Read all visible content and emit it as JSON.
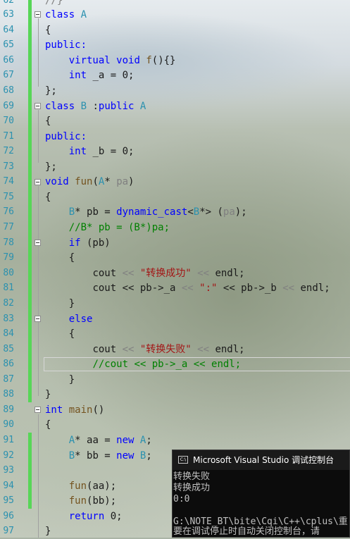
{
  "line_numbers": [
    "63",
    "64",
    "65",
    "66",
    "67",
    "68",
    "69",
    "70",
    "71",
    "72",
    "73",
    "74",
    "75",
    "76",
    "77",
    "78",
    "79",
    "80",
    "81",
    "82",
    "83",
    "84",
    "85",
    "86",
    "87",
    "88",
    "89",
    "90",
    "91",
    "92",
    "93",
    "94",
    "95",
    "96",
    "97"
  ],
  "top_partial": "//}",
  "code": {
    "l63": "class",
    "l63b": "A",
    "l64": "{",
    "l65": "public:",
    "l66a": "virtual",
    "l66b": "void",
    "l66c": "f",
    "l66d": "(){}",
    "l67a": "int",
    "l67b": " _a = 0;",
    "l68": "};",
    "l69a": "class",
    "l69b": "B",
    "l69c": " :",
    "l69d": "public",
    "l69e": "A",
    "l70": "{",
    "l71": "public:",
    "l72a": "int",
    "l72b": " _b = 0;",
    "l73": "};",
    "l74a": "void",
    "l74b": "fun",
    "l74c": "(",
    "l74d": "A",
    "l74e": "* ",
    "l74f": "pa",
    "l74g": ")",
    "l75": "{",
    "l76a": "B",
    "l76b": "* pb = ",
    "l76c": "dynamic_cast",
    "l76d": "<",
    "l76e": "B",
    "l76f": "*> (",
    "l76g": "pa",
    "l76h": ");",
    "l77": "//B* pb = (B*)pa;",
    "l78a": "if",
    "l78b": " (pb)",
    "l79": "{",
    "l80a": "cout",
    "l80b": " << ",
    "l80c": "\"转换成功\"",
    "l80d": " << ",
    "l80e": "endl",
    "l80f": ";",
    "l81a": "cout",
    "l81b": " << pb->",
    "l81c": "_a",
    "l81d": " << ",
    "l81e": "\":\"",
    "l81f": " << pb->",
    "l81g": "_b",
    "l81h": " << ",
    "l81i": "endl",
    "l81j": ";",
    "l82": "}",
    "l83": "else",
    "l84": "{",
    "l85a": "cout",
    "l85b": " << ",
    "l85c": "\"转换失败\"",
    "l85d": " << ",
    "l85e": "endl",
    "l85f": ";",
    "l86": "//cout << pb->_a << endl;",
    "l87": "}",
    "l88": "}",
    "l89a": "int",
    "l89b": " ",
    "l89c": "main",
    "l89d": "()",
    "l90": "{",
    "l91a": "A",
    "l91b": "* aa = ",
    "l91c": "new",
    "l91d": " ",
    "l91e": "A",
    "l91f": ";",
    "l92a": "B",
    "l92b": "* bb = ",
    "l92c": "new",
    "l92d": " ",
    "l92e": "B",
    "l92f": ";",
    "l94a": "fun",
    "l94b": "(aa);",
    "l95a": "fun",
    "l95b": "(bb);",
    "l96a": "return",
    "l96b": " 0;",
    "l97": "}"
  },
  "console": {
    "title": "Microsoft Visual Studio 调试控制台",
    "icon": "vs-console-icon",
    "lines": [
      "转换失败",
      "转换成功",
      "0:0",
      "",
      "G:\\NOTE_BT\\bite\\Cqi\\C++\\cplus\\重",
      "要在调试停止时自动关闭控制台，请"
    ]
  },
  "colors": {
    "keyword": "#0000ff",
    "type": "#2b91af",
    "function": "#74531f",
    "string": "#a31515",
    "comment": "#008000",
    "change_bar": "#57d657",
    "console_bg": "#0c0c0c"
  }
}
